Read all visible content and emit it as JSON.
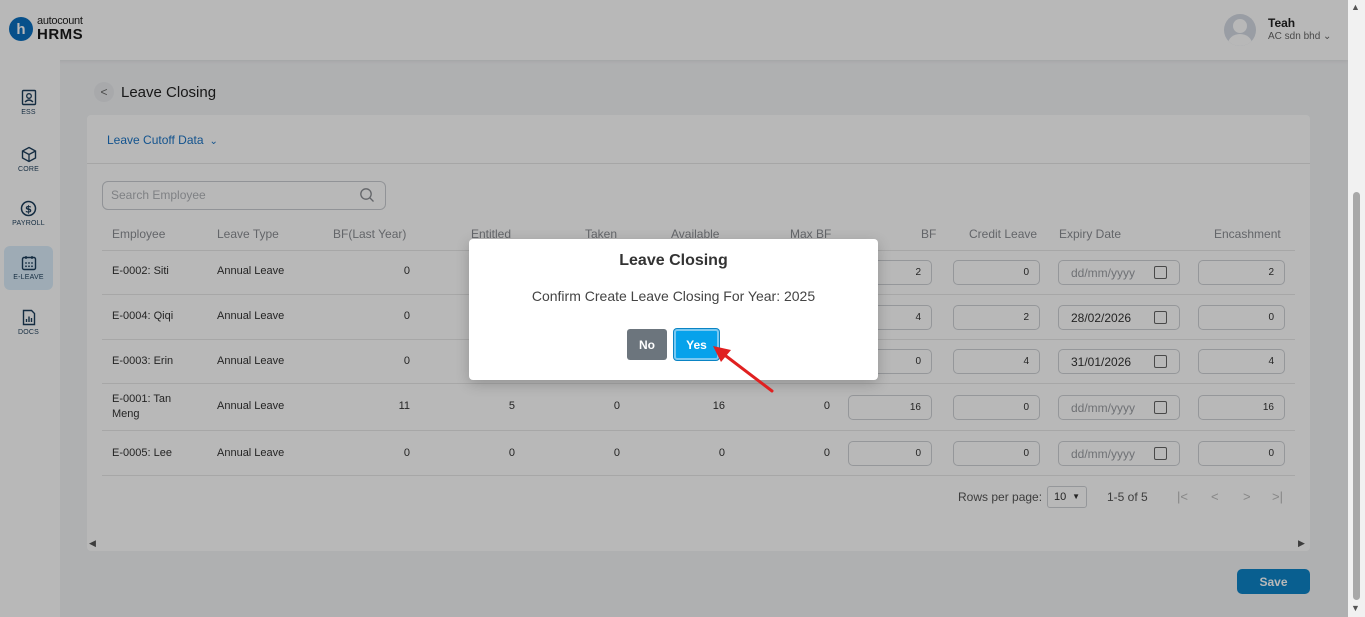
{
  "header": {
    "logo_letter": "h",
    "logo_sub": "autocount",
    "logo_main": "HRMS",
    "user_name": "Teah",
    "user_company": "AC sdn bhd"
  },
  "sidebar": {
    "items": [
      {
        "label": "ESS",
        "icon": "profile-icon"
      },
      {
        "label": "CORE",
        "icon": "cube-icon"
      },
      {
        "label": "PAYROLL",
        "icon": "dollar-icon"
      },
      {
        "label": "E-LEAVE",
        "icon": "calendar-icon",
        "active": true
      },
      {
        "label": "DOCS",
        "icon": "document-chart-icon"
      }
    ]
  },
  "page": {
    "title": "Leave Closing",
    "cutoff_label": "Leave Cutoff Data",
    "search_placeholder": "Search Employee"
  },
  "table": {
    "columns": [
      "Employee",
      "Leave Type",
      "BF(Last Year)",
      "Entitled",
      "Taken",
      "Available",
      "Max BF",
      "BF",
      "Credit Leave",
      "Expiry Date",
      "Encashment"
    ],
    "rows": [
      {
        "employee": "E-0002: Siti",
        "leave_type": "Annual Leave",
        "bf_last_year": "0",
        "entitled": "",
        "taken": "",
        "available": "",
        "max_bf": "",
        "bf": "2",
        "credit_leave": "0",
        "expiry": "dd/mm/yyyy",
        "expiry_placeholder": true,
        "encashment": "2"
      },
      {
        "employee": "E-0004: Qiqi",
        "leave_type": "Annual Leave",
        "bf_last_year": "0",
        "entitled": "",
        "taken": "",
        "available": "",
        "max_bf": "",
        "bf": "4",
        "credit_leave": "2",
        "expiry": "28/02/2026",
        "expiry_placeholder": false,
        "encashment": "0"
      },
      {
        "employee": "E-0003: Erin",
        "leave_type": "Annual Leave",
        "bf_last_year": "0",
        "entitled": "",
        "taken": "",
        "available": "",
        "max_bf": "",
        "bf": "0",
        "credit_leave": "4",
        "expiry": "31/01/2026",
        "expiry_placeholder": false,
        "encashment": "4"
      },
      {
        "employee": "E-0001: Tan Meng",
        "leave_type": "Annual Leave",
        "bf_last_year": "11",
        "entitled": "5",
        "taken": "0",
        "available": "16",
        "max_bf": "0",
        "bf": "16",
        "credit_leave": "0",
        "expiry": "dd/mm/yyyy",
        "expiry_placeholder": true,
        "encashment": "16"
      },
      {
        "employee": "E-0005: Lee",
        "leave_type": "Annual Leave",
        "bf_last_year": "0",
        "entitled": "0",
        "taken": "0",
        "available": "0",
        "max_bf": "0",
        "bf": "0",
        "credit_leave": "0",
        "expiry": "dd/mm/yyyy",
        "expiry_placeholder": true,
        "encashment": "0"
      }
    ]
  },
  "pagination": {
    "rows_per_page_label": "Rows per page:",
    "rows_per_page": "10",
    "range": "1-5 of 5"
  },
  "save_label": "Save",
  "modal": {
    "title": "Leave Closing",
    "message": "Confirm Create Leave Closing For Year: 2025",
    "no_label": "No",
    "yes_label": "Yes"
  },
  "colors": {
    "accent": "#0d84c8",
    "yes_button": "#06a2eb",
    "no_button": "#6c757d",
    "link": "#1b74c5",
    "annotation_arrow": "#e02020"
  }
}
